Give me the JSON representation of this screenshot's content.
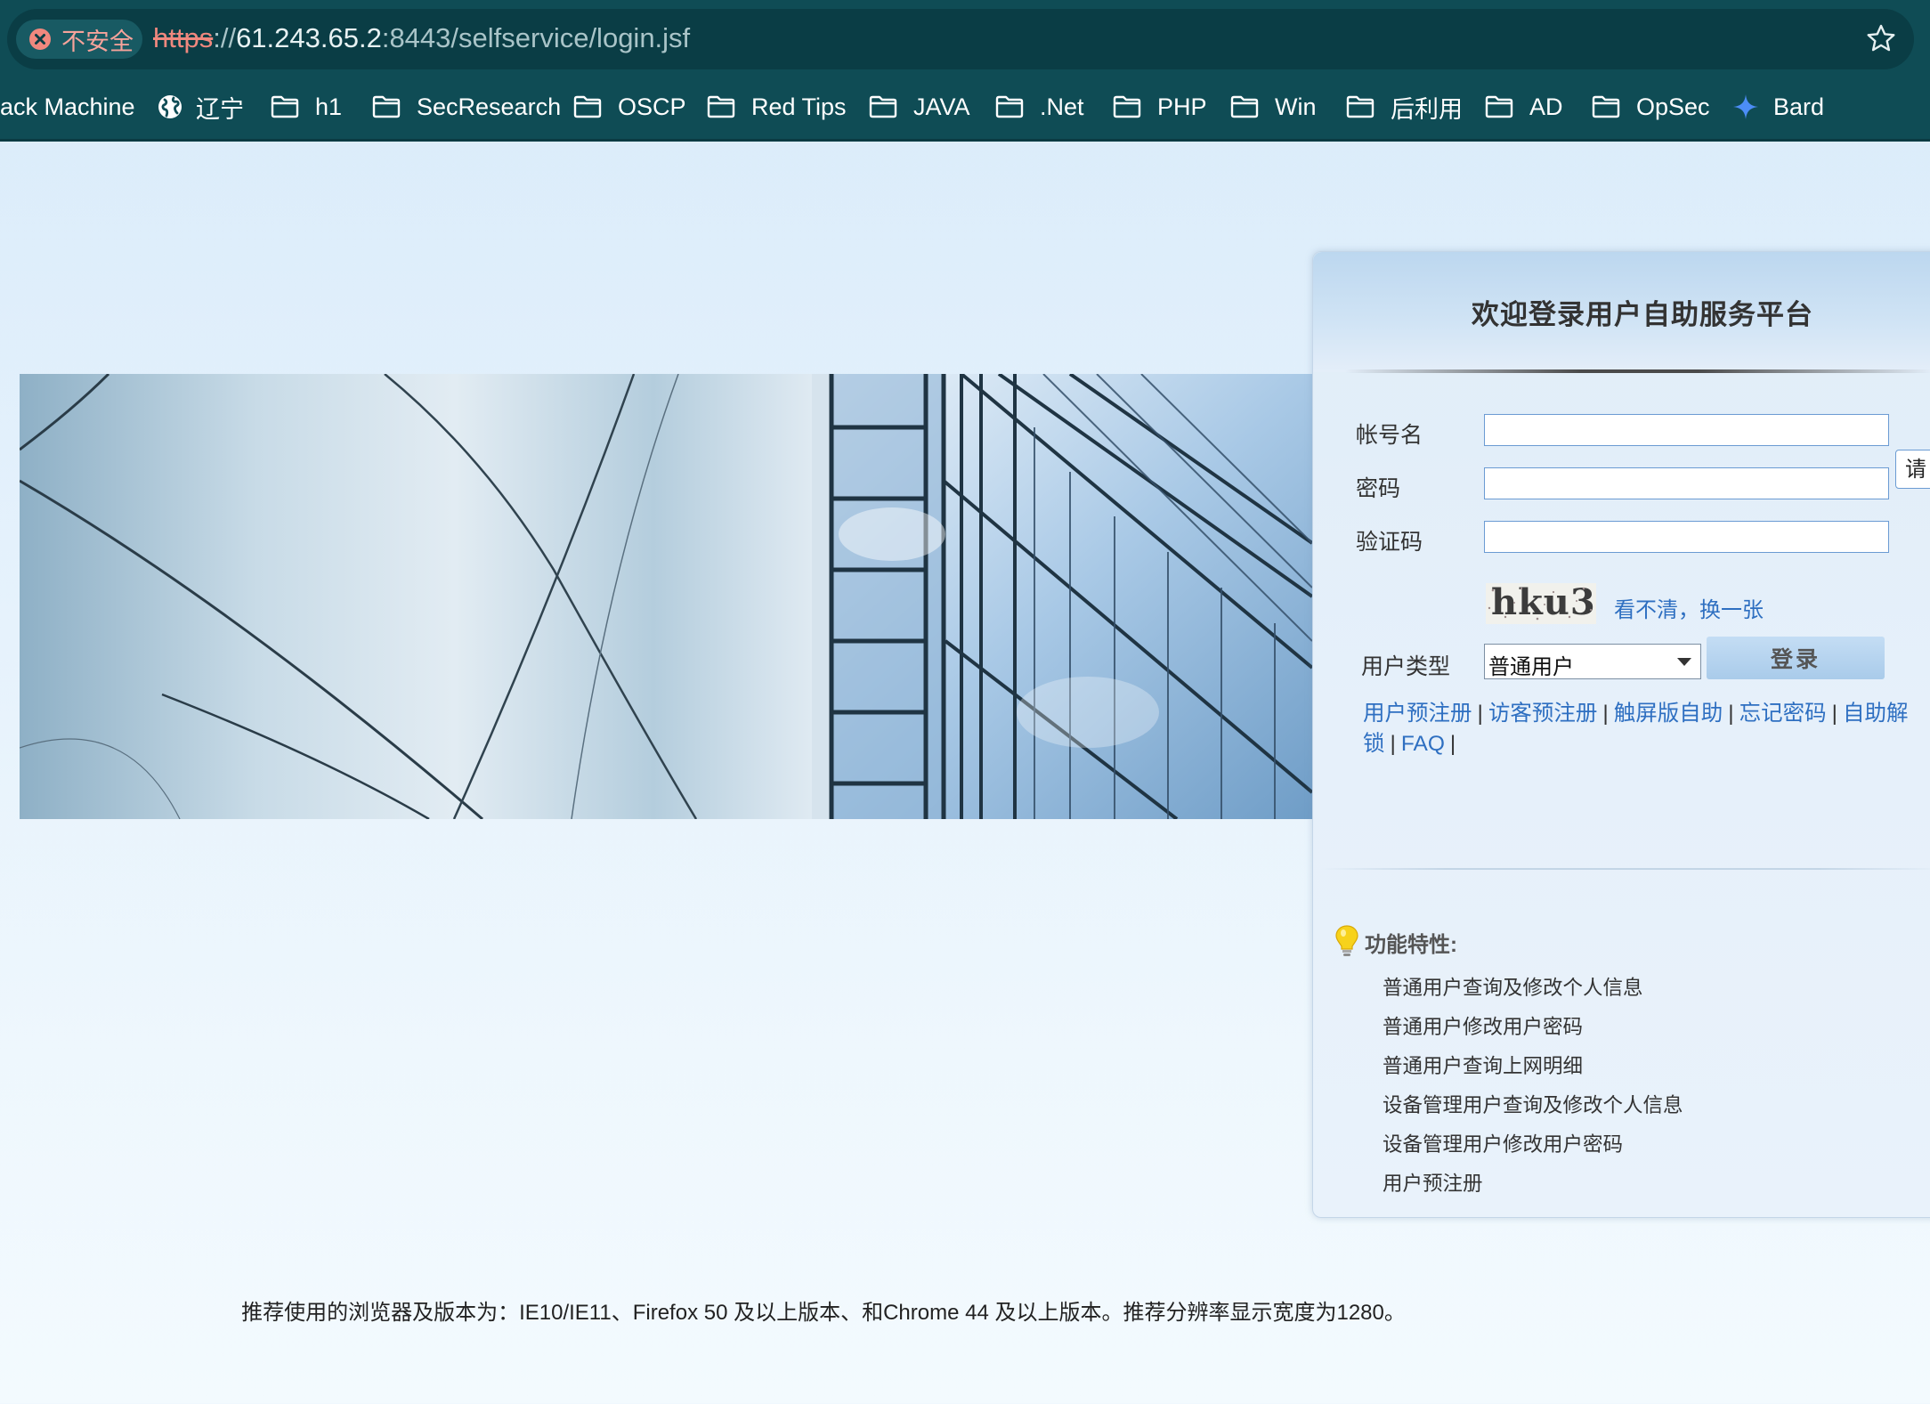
{
  "browser": {
    "security_label": "不安全",
    "url_scheme": "https",
    "url_sep": "://",
    "url_host": "61.243.65.2",
    "url_rest": ":8443/selfservice/login.jsf",
    "bookmarks": [
      {
        "label": "ack Machine",
        "icon": "none"
      },
      {
        "label": "辽宁",
        "icon": "globe-icon"
      },
      {
        "label": "h1",
        "icon": "folder-icon"
      },
      {
        "label": "SecResearch",
        "icon": "folder-icon"
      },
      {
        "label": "OSCP",
        "icon": "folder-icon"
      },
      {
        "label": "Red Tips",
        "icon": "folder-icon"
      },
      {
        "label": "JAVA",
        "icon": "folder-icon"
      },
      {
        "label": ".Net",
        "icon": "folder-icon"
      },
      {
        "label": "PHP",
        "icon": "folder-icon"
      },
      {
        "label": "Win",
        "icon": "folder-icon"
      },
      {
        "label": "后利用",
        "icon": "folder-icon"
      },
      {
        "label": "AD",
        "icon": "folder-icon"
      },
      {
        "label": "OpSec",
        "icon": "folder-icon"
      },
      {
        "label": "Bard",
        "icon": "sparkle-icon"
      }
    ],
    "colors": {
      "chrome": "#0f4c55",
      "warning": "#f0887e"
    }
  },
  "login": {
    "title": "欢迎登录用户自助服务平台",
    "account_label": "帐号名",
    "account_value": "",
    "password_label": "密码",
    "password_value": "",
    "captcha_label": "验证码",
    "captcha_value": "",
    "captcha_text": "hku3",
    "captcha_refresh": "看不清，换一张",
    "tooltip_text": "请",
    "usertype_label": "用户类型",
    "usertype_value": "普通用户",
    "login_button": "登录",
    "links": [
      "用户预注册",
      "访客预注册",
      "触屏版自助",
      "忘记密码",
      "自助解锁",
      "FAQ"
    ],
    "link_separator": "|",
    "accent_color": "#2e6fc1"
  },
  "features": {
    "title": "功能特性:",
    "items": [
      "普通用户查询及修改个人信息",
      "普通用户修改用户密码",
      "普通用户查询上网明细",
      "设备管理用户查询及修改个人信息",
      "设备管理用户修改用户密码",
      "用户预注册"
    ]
  },
  "footer": {
    "note": "推荐使用的浏览器及版本为：IE10/IE11、Firefox 50 及以上版本、和Chrome 44 及以上版本。推荐分辨率显示宽度为1280。"
  }
}
